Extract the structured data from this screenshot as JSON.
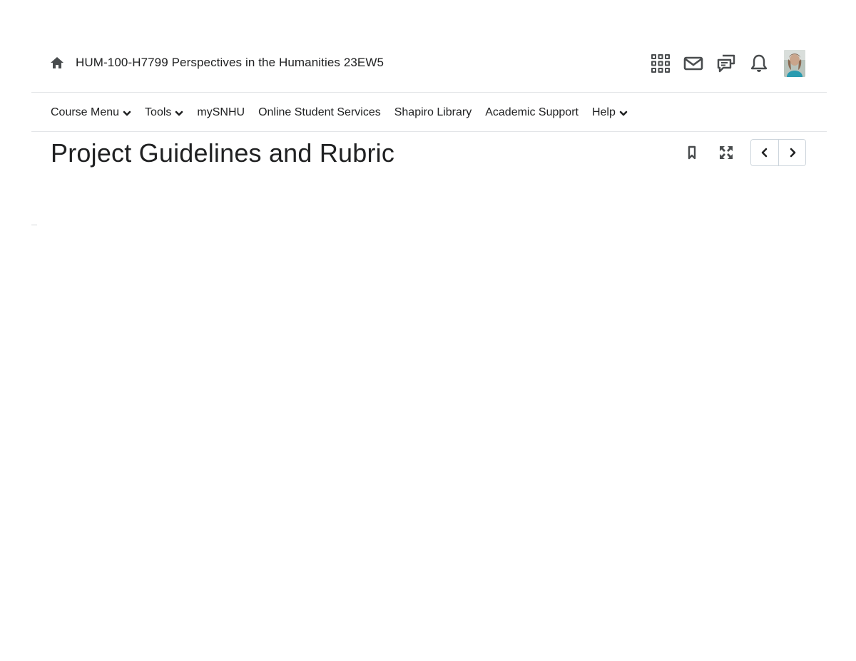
{
  "header": {
    "course_title": "HUM-100-H7799 Perspectives in the Humanities 23EW5",
    "icons": [
      "waffle-icon",
      "mail-icon",
      "chat-icon",
      "bell-icon"
    ]
  },
  "nav": {
    "items": [
      {
        "label": "Course Menu",
        "dropdown": true
      },
      {
        "label": "Tools",
        "dropdown": true
      },
      {
        "label": "mySNHU",
        "dropdown": false
      },
      {
        "label": "Online Student Services",
        "dropdown": false
      },
      {
        "label": "Shapiro Library",
        "dropdown": false
      },
      {
        "label": "Academic Support",
        "dropdown": false
      },
      {
        "label": "Help",
        "dropdown": true
      }
    ]
  },
  "main": {
    "title": "Project Guidelines and Rubric"
  },
  "colors": {
    "text": "#202122",
    "border": "#e3e5e8",
    "icon": "#494c4e"
  }
}
